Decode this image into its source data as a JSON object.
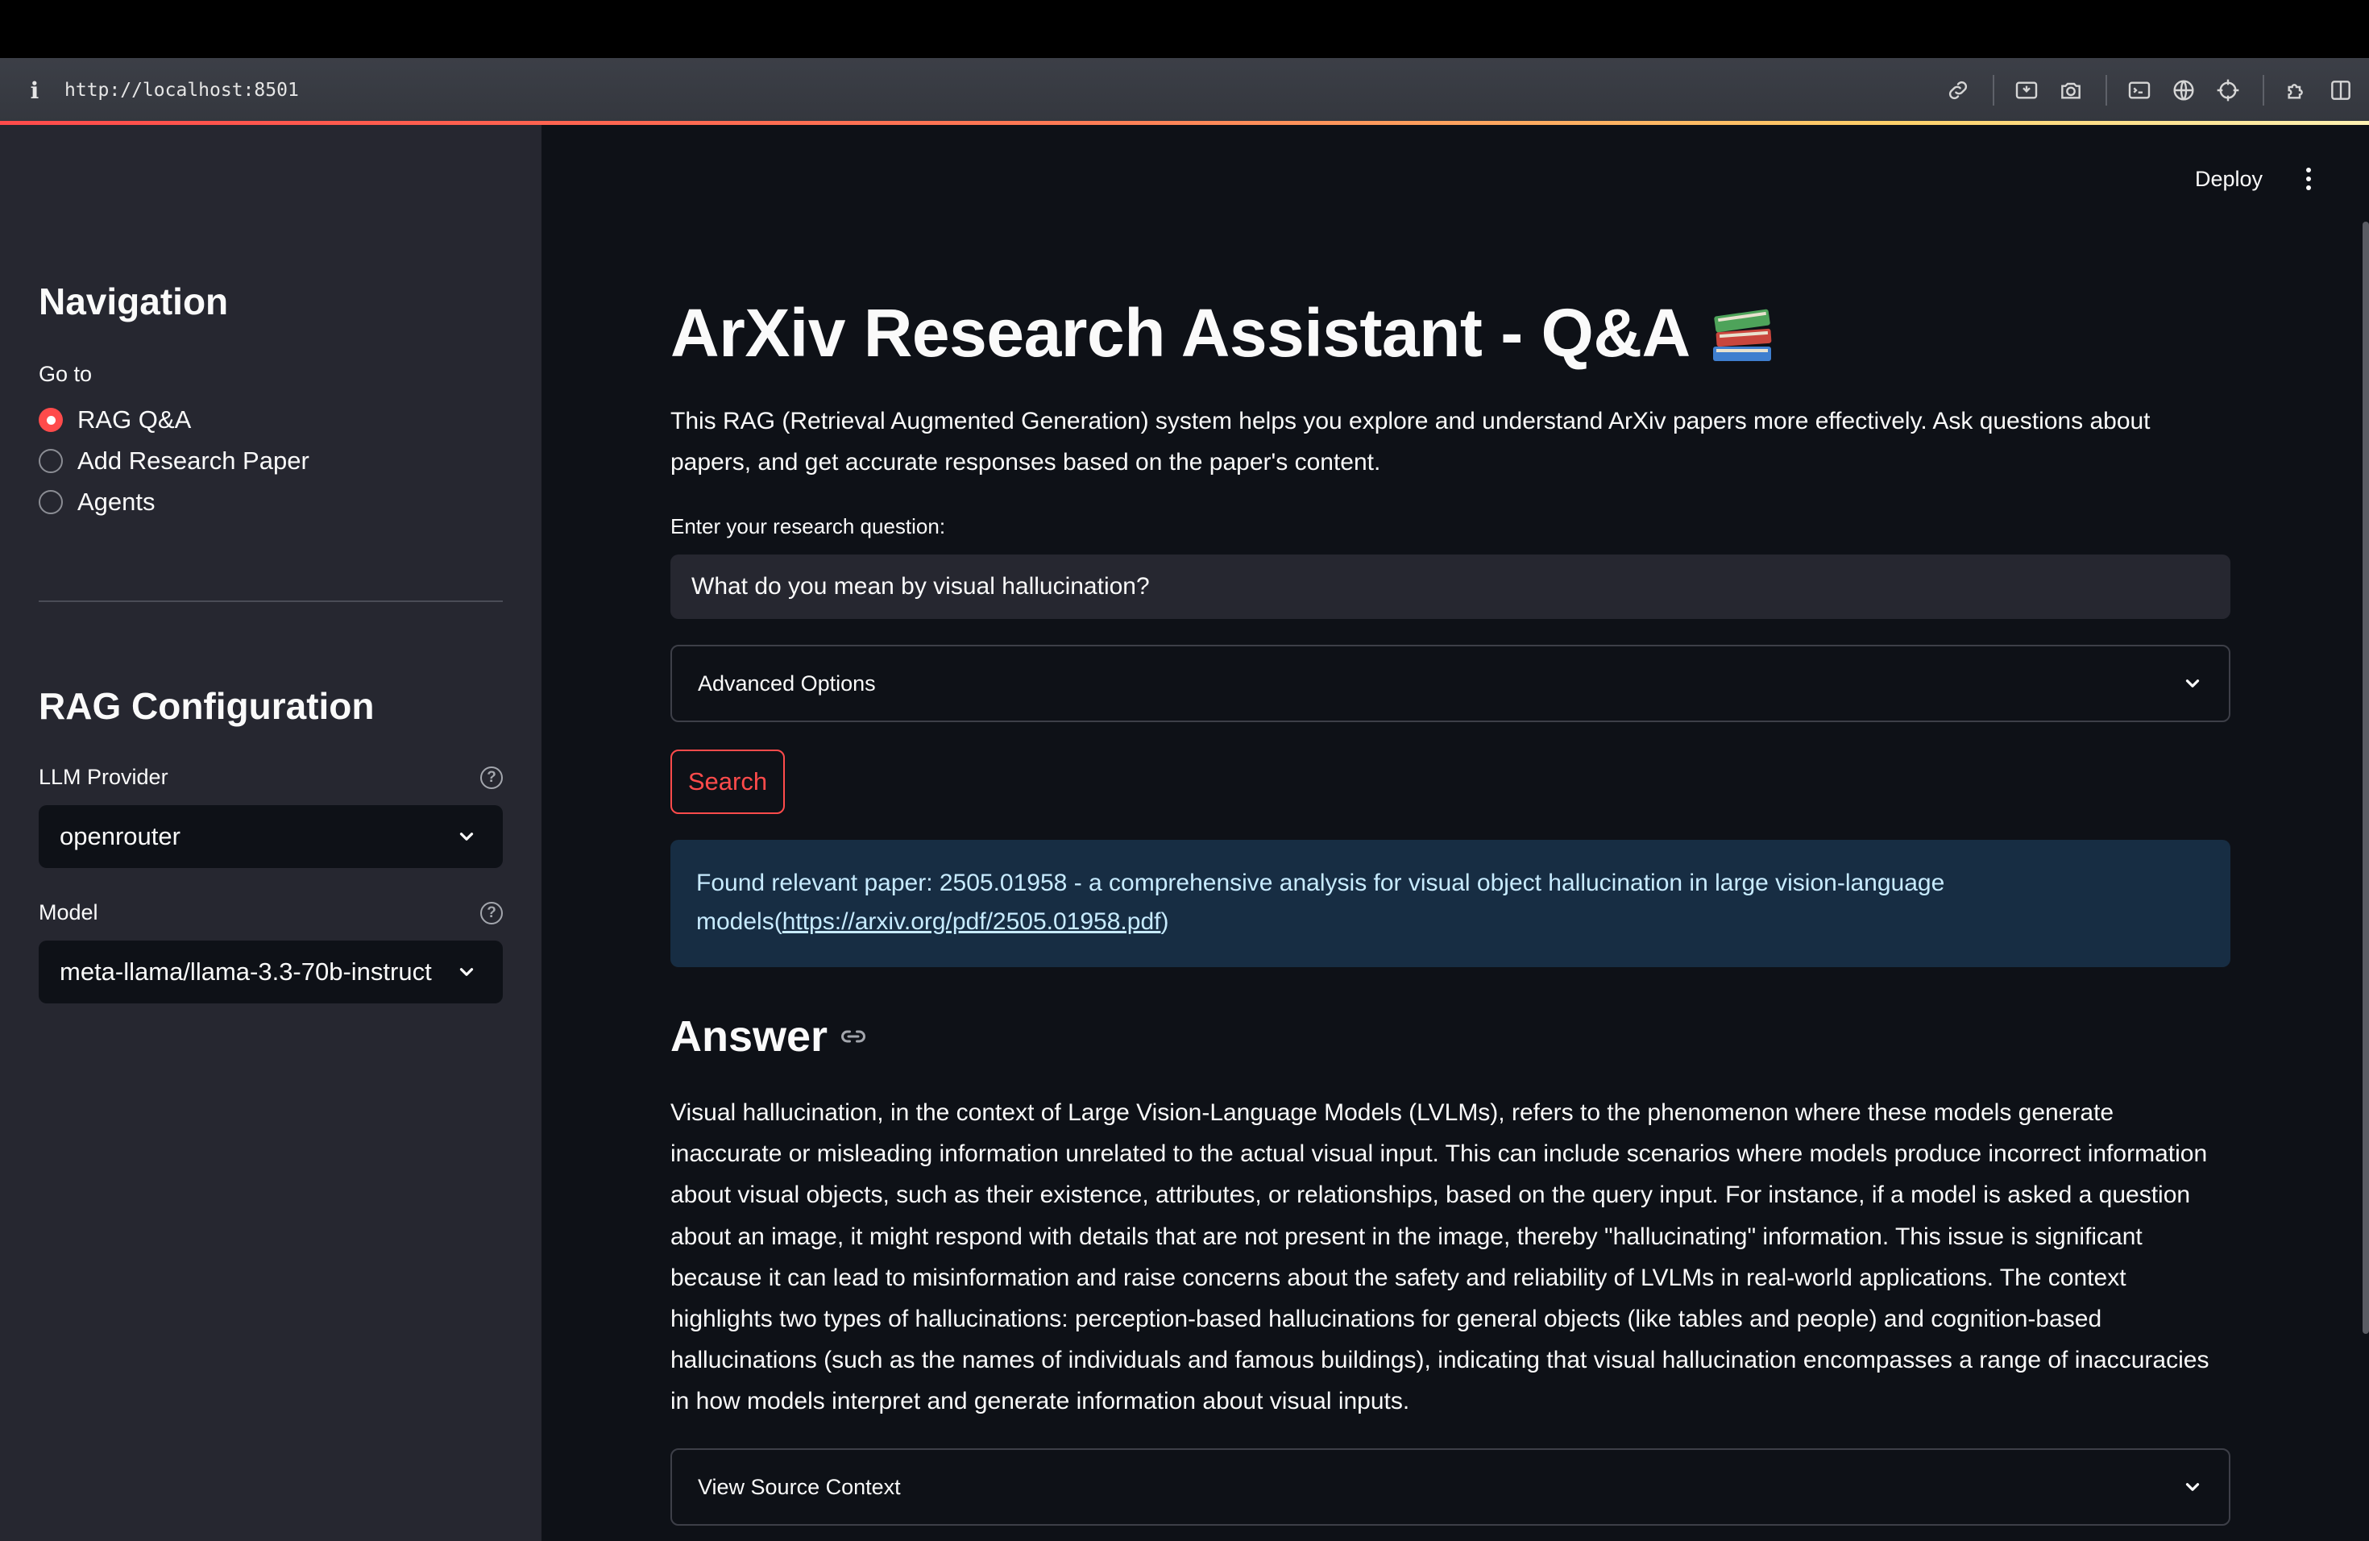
{
  "browser": {
    "info_glyph": "i",
    "url": "http://localhost:8501",
    "tools": [
      "link-icon",
      "screen-capture-icon",
      "camera-icon",
      "terminal-icon",
      "globe-icon",
      "crosshair-icon",
      "extension-icon",
      "split-view-icon"
    ]
  },
  "header": {
    "deploy_label": "Deploy"
  },
  "sidebar": {
    "nav_title": "Navigation",
    "goto_label": "Go to",
    "nav_options": [
      {
        "label": "RAG Q&A",
        "selected": true
      },
      {
        "label": "Add Research Paper",
        "selected": false
      },
      {
        "label": "Agents",
        "selected": false
      }
    ],
    "config_title": "RAG Configuration",
    "provider_label": "LLM Provider",
    "provider_value": "openrouter",
    "model_label": "Model",
    "model_value": "meta-llama/llama-3.3-70b-instruct",
    "help_glyph": "?"
  },
  "main": {
    "title": "ArXiv Research Assistant - Q&A",
    "intro": "This RAG (Retrieval Augmented Generation) system helps you explore and understand ArXiv papers more effectively. Ask questions about papers, and get accurate responses based on the paper's content.",
    "question_label": "Enter your research question:",
    "question_value": "What do you mean by visual hallucination?",
    "advanced_label": "Advanced Options",
    "search_label": "Search",
    "found_text": "Found relevant paper: 2505.01958 - a comprehensive analysis for visual object hallucination in large vision-language models(",
    "found_link": "https://arxiv.org/pdf/2505.01958.pdf",
    "found_close": ")",
    "answer_heading": "Answer",
    "answer_text": "Visual hallucination, in the context of Large Vision-Language Models (LVLMs), refers to the phenomenon where these models generate inaccurate or misleading information unrelated to the actual visual input. This can include scenarios where models produce incorrect information about visual objects, such as their existence, attributes, or relationships, based on the query input. For instance, if a model is asked a question about an image, it might respond with details that are not present in the image, thereby \"hallucinating\" information. This issue is significant because it can lead to misinformation and raise concerns about the safety and reliability of LVLMs in real-world applications. The context highlights two types of hallucinations: perception-based hallucinations for general objects (like tables and people) and cognition-based hallucinations (such as the names of individuals and famous buildings), indicating that visual hallucination encompasses a range of inaccuracies in how models interpret and generate information about visual inputs.",
    "source_label": "View Source Context"
  },
  "colors": {
    "accent": "#ff4b4b",
    "sidebar_bg": "#262730",
    "main_bg": "#0e1117",
    "info_bg": "#172d43"
  }
}
